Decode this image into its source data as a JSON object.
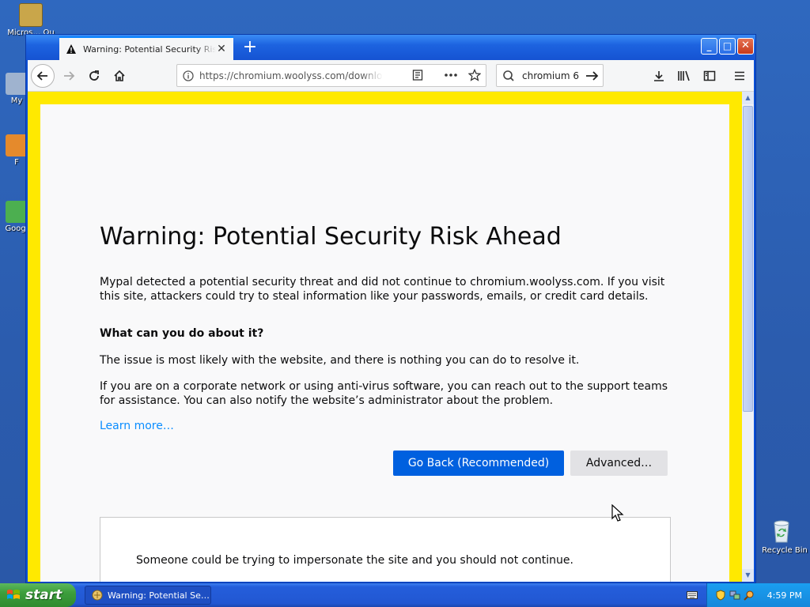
{
  "desktop": {
    "icons": [
      {
        "label": "Microsoft Outlook",
        "short": "Micros… Ou"
      },
      {
        "label": "My",
        "short": "My"
      },
      {
        "label": "F",
        "short": "F"
      },
      {
        "label": "Google",
        "short": "Googl"
      }
    ],
    "recycle_bin": "Recycle Bin"
  },
  "browser": {
    "tab_title": "Warning: Potential Security Risk Ahead",
    "new_tab": "+",
    "url": "https://chromium.woolyss.com/download/",
    "search_text": "chromium 6",
    "window_buttons": {
      "minimize": "_",
      "maximize": "□",
      "close": "✕"
    }
  },
  "page": {
    "title": "Warning: Potential Security Risk Ahead",
    "intro": "Mypal detected a potential security threat and did not continue to chromium.woolyss.com. If you visit this site, attackers could try to steal information like your passwords, emails, or credit card details.",
    "what_heading": "What can you do about it?",
    "issue": "The issue is most likely with the website, and there is nothing you can do to resolve it.",
    "corporate": "If you are on a corporate network or using anti-virus software, you can reach out to the support teams for assistance. You can also notify the website’s administrator about the problem.",
    "learn_more": "Learn more…",
    "go_back": "Go Back (Recommended)",
    "advanced": "Advanced…",
    "advanced_text": "Someone could be trying to impersonate the site and you should not continue."
  },
  "taskbar": {
    "start": "start",
    "task_title": "Warning: Potential Se…",
    "clock": "4:59 PM"
  },
  "colors": {
    "accent_yellow": "#ffe900",
    "primary_button": "#0060df",
    "link": "#0a8dff"
  }
}
